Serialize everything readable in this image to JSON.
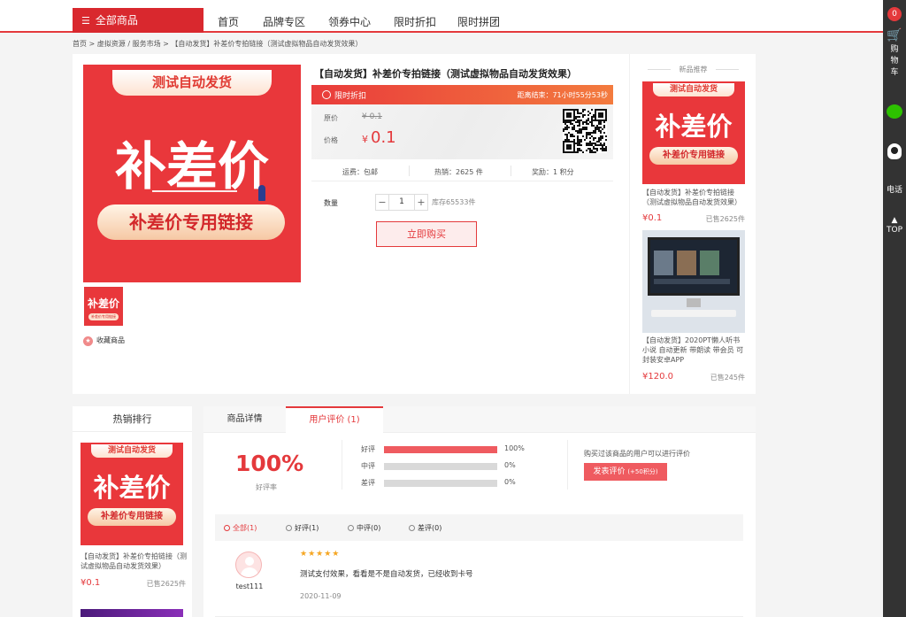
{
  "nav": {
    "all_categories": "全部商品",
    "links": [
      "首页",
      "品牌专区",
      "领券中心",
      "限时折扣",
      "限时拼团"
    ]
  },
  "sidebar": {
    "cart_count": "0",
    "cart_label": "购物车",
    "phone_label": "电话",
    "top_label": "TOP"
  },
  "breadcrumb": "首页 > 虚拟资源 / 服务市场 > 【自动发货】补差价专拍链接（测试虚拟物品自动发货效果）",
  "product": {
    "title": "【自动发货】补差价专拍链接（测试虚拟物品自动发货效果）",
    "image": {
      "top_pill": "测试自动发货",
      "headline": "补差价",
      "sub_pill": "补差价专用链接"
    },
    "flash_label": "限时折扣",
    "countdown": "距离结束：71小时55分53秒",
    "original_label": "原价",
    "original_price": "¥ 0.1",
    "price_label": "价格",
    "currency": "¥",
    "price": "0.1",
    "shipping": "运费：包邮",
    "sales": "热销：2625 件",
    "reward": "奖励：1 积分",
    "qty_label": "数量",
    "qty_minus": "−",
    "qty_value": "1",
    "qty_plus": "+",
    "stock": "库存65533件",
    "buy_label": "立即购买",
    "favorite_label": "收藏商品"
  },
  "recommend": {
    "title": "新品推荐",
    "items": [
      {
        "name": "【自动发货】补差价专拍链接（测试虚拟物品自动发货效果）",
        "price": "¥0.1",
        "sold": "已售2625件"
      },
      {
        "name": "【自动发货】2020PT懒人听书小说 自动更新 带朗读 带会员 可封装安卓APP",
        "price": "¥120.0",
        "sold": "已售245件"
      }
    ]
  },
  "hot": {
    "title": "热销排行",
    "item": {
      "name": "【自动发货】补差价专拍链接（测试虚拟物品自动发货效果）",
      "price": "¥0.1",
      "sold": "已售2625件"
    }
  },
  "detail": {
    "tab_detail": "商品详情",
    "tab_review": "用户评价 (1)",
    "good_rate": "100%",
    "good_rate_label": "好评率",
    "bars": [
      {
        "label": "好评",
        "pct": "100%",
        "value": 100
      },
      {
        "label": "中评",
        "pct": "0%",
        "value": 0
      },
      {
        "label": "差评",
        "pct": "0%",
        "value": 0
      }
    ],
    "hint": "购买过该商品的用户可以进行评价",
    "write_label": "发表评价",
    "write_bonus": "(+50积分)",
    "filters": [
      "全部(1)",
      "好评(1)",
      "中评(0)",
      "差评(0)"
    ],
    "review": {
      "user": "test111",
      "stars": "★★★★★",
      "text": "测试支付效果，看看是不是自动发货，已经收到卡号",
      "date": "2020-11-09"
    }
  }
}
